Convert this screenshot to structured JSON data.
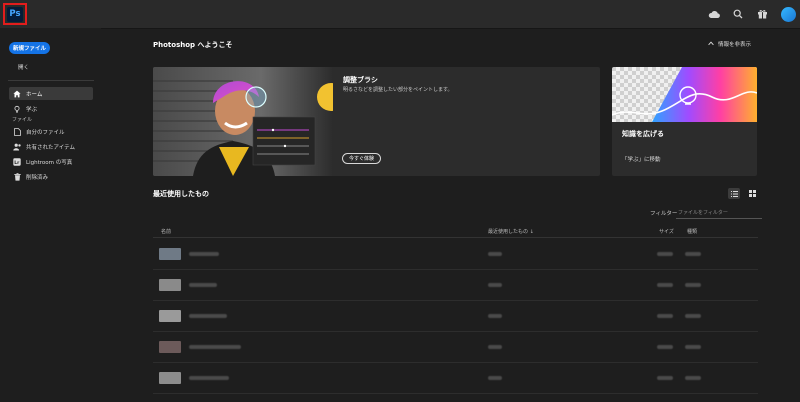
{
  "app": {
    "logo_text": "Ps"
  },
  "topbar": {
    "icons": [
      "cloud-icon",
      "search-icon",
      "gift-icon",
      "avatar"
    ]
  },
  "sidebar": {
    "new_file_label": "新規ファイル",
    "open_label": "開く",
    "section_label": "ファイル",
    "nav": [
      {
        "label": "ホーム",
        "icon": "home-icon",
        "active": true
      },
      {
        "label": "学ぶ",
        "icon": "lightbulb-icon",
        "active": false
      }
    ],
    "files": [
      {
        "label": "自分のファイル",
        "icon": "file-icon"
      },
      {
        "label": "共有されたアイテム",
        "icon": "people-icon"
      },
      {
        "label": "Lightroom の写真",
        "icon": "lightroom-icon"
      },
      {
        "label": "削除済み",
        "icon": "trash-icon"
      }
    ]
  },
  "header": {
    "title": "Photoshop へようこそ",
    "hide_info_label": "情報を非表示"
  },
  "feature_card": {
    "title": "調整ブラシ",
    "description": "明るさなどを調整したい部分をペイントします。",
    "button_label": "今すぐ体験"
  },
  "learn_card": {
    "title": "知識を広げる",
    "link_label": "「学ぶ」に移動"
  },
  "recent": {
    "title": "最近使用したもの",
    "filter_label": "フィルター",
    "filter_placeholder": "ファイルをフィルター",
    "columns": {
      "name": "名前",
      "last_used": "最近使用したもの ↓",
      "size": "サイズ",
      "kind": "種類"
    },
    "rows": [
      {
        "thumb_color": "#6f7a86"
      },
      {
        "thumb_color": "#8a8a8a"
      },
      {
        "thumb_color": "#9a9a9a"
      },
      {
        "thumb_color": "#6c5a5a"
      },
      {
        "thumb_color": "#8d8d8d"
      }
    ]
  },
  "colors": {
    "accent": "#1473e6",
    "ps_logo_bg": "#041c38",
    "ps_logo_text": "#45a7ff"
  }
}
